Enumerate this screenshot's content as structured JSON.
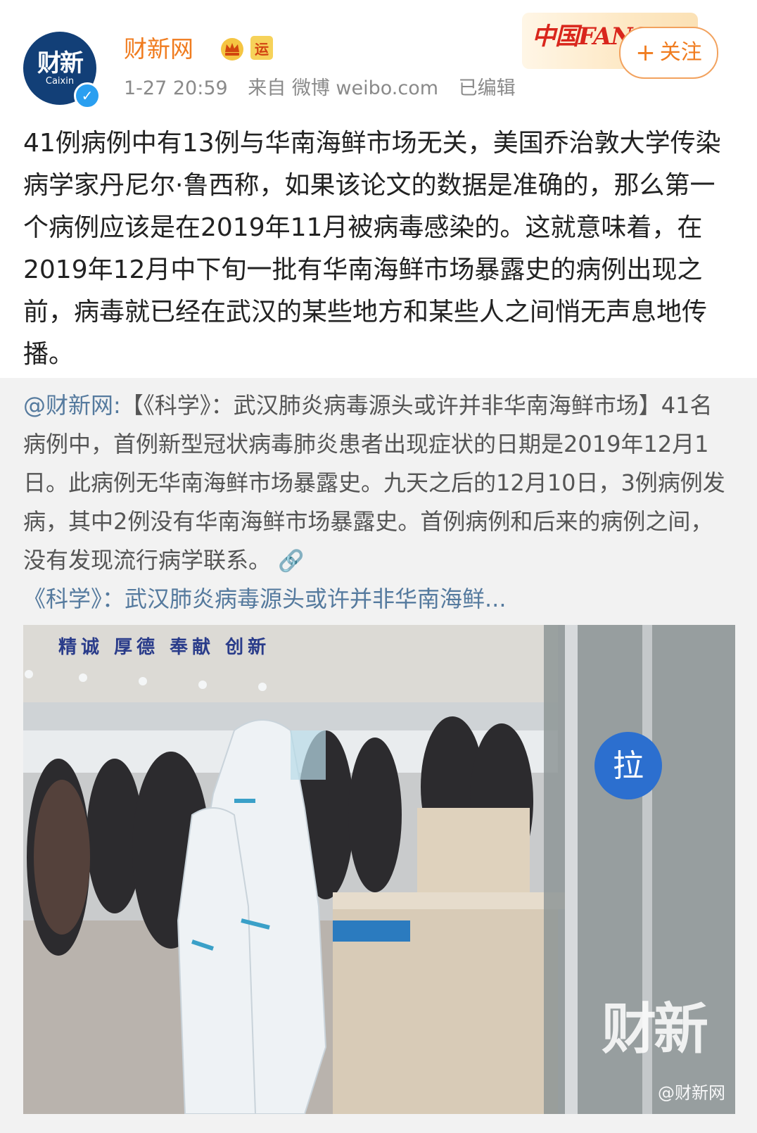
{
  "account": {
    "name": "财新网",
    "avatar_logo": "财新",
    "avatar_sub": "Caixin",
    "verified_mark": "✓",
    "yun_badge": "运"
  },
  "meta": {
    "time": "1-27 20:59",
    "source": "来自 微博 weibo.com",
    "edited": "已编辑"
  },
  "fans_badge": "中国FANS",
  "follow_button": {
    "plus": "+",
    "label": "关注"
  },
  "post_text": "41例病例中有13例与华南海鲜市场无关，美国乔治敦大学传染病学家丹尼尔·鲁西称，如果该论文的数据是准确的，那么第一个病例应该是在2019年11月被病毒感染的。这就意味着，在2019年12月中下旬一批有华南海鲜市场暴露史的病例出现之前，病毒就已经在武汉的某些地方和某些人之间悄无声息地传播。",
  "repost": {
    "mention": "@财新网:",
    "text": "【《科学》：武汉肺炎病毒源头或许并非华南海鲜市场】41名病例中，首例新型冠状病毒肺炎患者出现症状的日期是2019年12月1日。此病例无华南海鲜市场暴露史。九天之后的12月10日，3例病例发病，其中2例没有华南海鲜市场暴露史。首例病例和后来的病例之间，没有发现流行病学联系。",
    "link_icon": "link-icon",
    "link_text": "《科学》：武汉肺炎病毒源头或许并非华南海鲜..."
  },
  "photo": {
    "banner_text": "精诚 厚德 奉献 创新",
    "door_sign": "拉",
    "watermark": "财新",
    "credit": "@财新网"
  },
  "colors": {
    "accent_orange": "#f07c1f",
    "link_blue": "#557a9e",
    "avatar_navy": "#123f77",
    "repost_bg": "#f2f2f2"
  }
}
